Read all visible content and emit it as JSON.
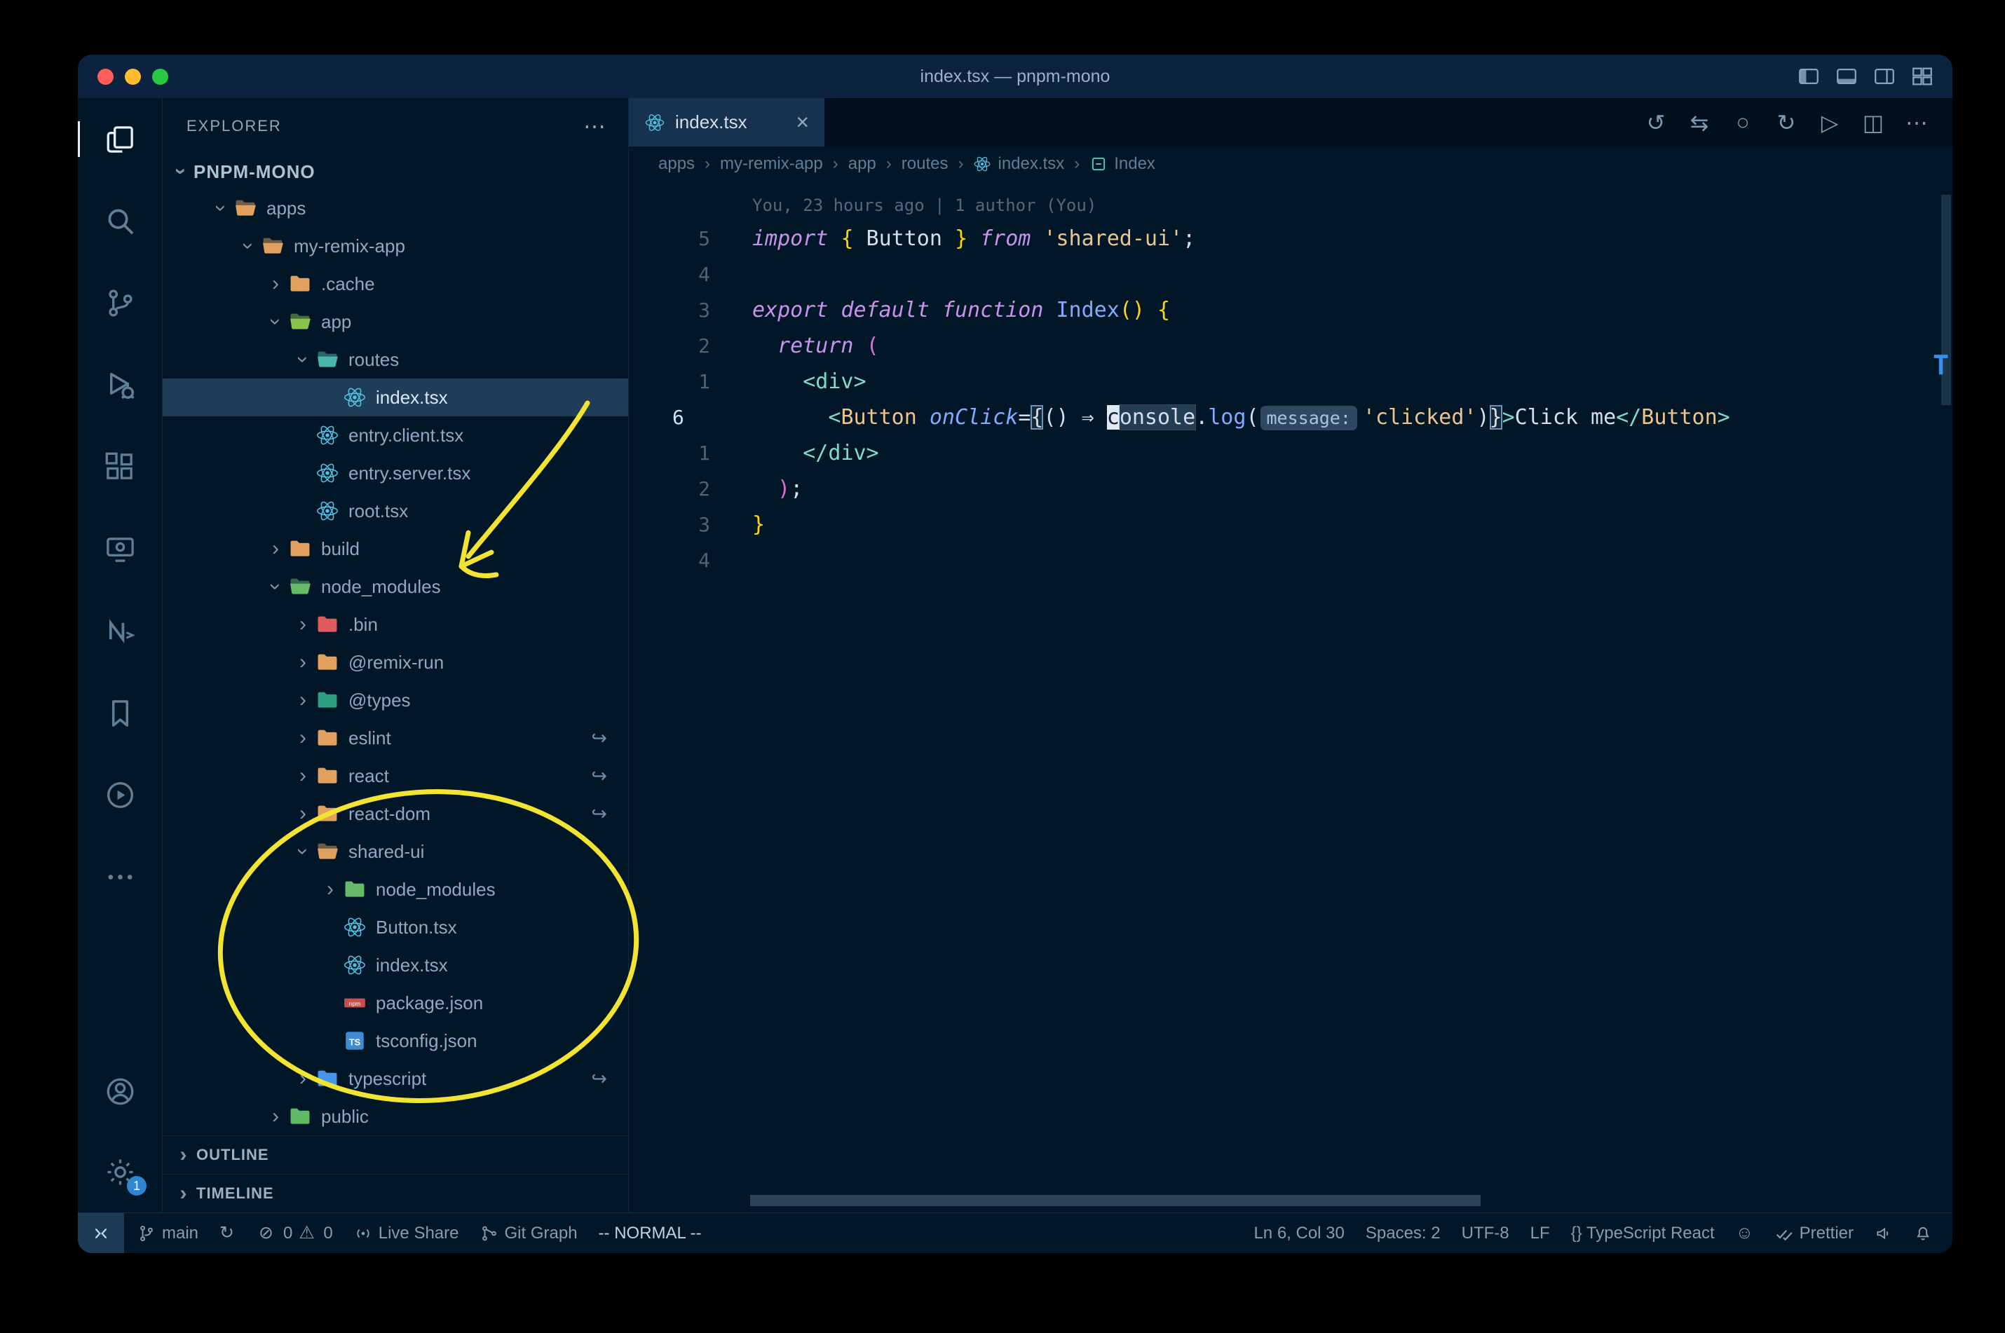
{
  "window": {
    "title": "index.tsx — pnpm-mono"
  },
  "title_bar": {
    "actions": [
      {
        "name": "toggle-sidebar"
      },
      {
        "name": "toggle-panel"
      },
      {
        "name": "toggle-secondary-sidebar"
      },
      {
        "name": "customize-layout"
      }
    ]
  },
  "activity_bar": {
    "items": [
      {
        "name": "explorer",
        "active": true
      },
      {
        "name": "search"
      },
      {
        "name": "source-control"
      },
      {
        "name": "run-debug"
      },
      {
        "name": "extensions"
      },
      {
        "name": "remote-explorer"
      },
      {
        "name": "nx-console"
      },
      {
        "name": "bookmarks"
      },
      {
        "name": "code-runner"
      },
      {
        "name": "more-actions"
      }
    ],
    "bottom": [
      {
        "name": "accounts"
      },
      {
        "name": "settings",
        "badge": "1"
      }
    ]
  },
  "explorer": {
    "header": "EXPLORER",
    "more_icon": "ellipsis",
    "root": "PNPM-MONO",
    "items": [
      {
        "label": "apps",
        "level": 1,
        "chevron": "expanded",
        "icon": "folder-open",
        "color": "#e2a05e"
      },
      {
        "label": "my-remix-app",
        "level": 2,
        "chevron": "expanded",
        "icon": "folder-open",
        "color": "#e2a05e"
      },
      {
        "label": ".cache",
        "level": 3,
        "chevron": "collapsed",
        "icon": "folder",
        "color": "#e2a05e"
      },
      {
        "label": "app",
        "level": 3,
        "chevron": "expanded",
        "icon": "folder-open",
        "color": "#8ac34b"
      },
      {
        "label": "routes",
        "level": 4,
        "chevron": "expanded",
        "icon": "folder-open",
        "color": "#4db6ac"
      },
      {
        "label": "index.tsx",
        "level": 5,
        "icon": "react",
        "selected": true
      },
      {
        "label": "entry.client.tsx",
        "level": 4,
        "icon": "react"
      },
      {
        "label": "entry.server.tsx",
        "level": 4,
        "icon": "react"
      },
      {
        "label": "root.tsx",
        "level": 4,
        "icon": "react"
      },
      {
        "label": "build",
        "level": 3,
        "chevron": "collapsed",
        "icon": "folder",
        "color": "#e2a05e"
      },
      {
        "label": "node_modules",
        "level": 3,
        "chevron": "expanded",
        "icon": "folder-open",
        "color": "#66bb6a"
      },
      {
        "label": ".bin",
        "level": 4,
        "chevron": "collapsed",
        "icon": "folder",
        "color": "#e05c5c"
      },
      {
        "label": "@remix-run",
        "level": 4,
        "chevron": "collapsed",
        "icon": "folder",
        "color": "#e2a05e"
      },
      {
        "label": "@types",
        "level": 4,
        "chevron": "collapsed",
        "icon": "folder",
        "color": "#2e9f7f"
      },
      {
        "label": "eslint",
        "level": 4,
        "chevron": "collapsed",
        "icon": "folder",
        "color": "#e2a05e",
        "symlink": true
      },
      {
        "label": "react",
        "level": 4,
        "chevron": "collapsed",
        "icon": "folder",
        "color": "#e2a05e",
        "symlink": true
      },
      {
        "label": "react-dom",
        "level": 4,
        "chevron": "collapsed",
        "icon": "folder",
        "color": "#e2a05e",
        "symlink": true
      },
      {
        "label": "shared-ui",
        "level": 4,
        "chevron": "expanded",
        "icon": "folder-open",
        "color": "#e2a05e"
      },
      {
        "label": "node_modules",
        "level": 5,
        "chevron": "collapsed",
        "icon": "folder",
        "color": "#66bb6a"
      },
      {
        "label": "Button.tsx",
        "level": 5,
        "icon": "react"
      },
      {
        "label": "index.tsx",
        "level": 5,
        "icon": "react"
      },
      {
        "label": "package.json",
        "level": 5,
        "icon": "npm"
      },
      {
        "label": "tsconfig.json",
        "level": 5,
        "icon": "ts"
      },
      {
        "label": "typescript",
        "level": 4,
        "chevron": "collapsed",
        "icon": "folder",
        "color": "#4596e8",
        "symlink": true
      },
      {
        "label": "public",
        "level": 3,
        "chevron": "collapsed",
        "icon": "folder",
        "color": "#5fb965"
      }
    ],
    "sections": [
      "OUTLINE",
      "TIMELINE"
    ]
  },
  "tabs": [
    {
      "label": "index.tsx",
      "icon": "react",
      "active": true
    }
  ],
  "editor_actions": [
    {
      "name": "timeline",
      "glyph": "↺"
    },
    {
      "name": "compare-changes",
      "glyph": "⇆"
    },
    {
      "name": "record",
      "glyph": "○"
    },
    {
      "name": "sync-file",
      "glyph": "↻"
    },
    {
      "name": "run-file",
      "glyph": "▷"
    },
    {
      "name": "split-editor",
      "glyph": "◫"
    },
    {
      "name": "more-actions",
      "glyph": "⋯"
    }
  ],
  "breadcrumbs": [
    {
      "label": "apps"
    },
    {
      "label": "my-remix-app"
    },
    {
      "label": "app"
    },
    {
      "label": "routes"
    },
    {
      "label": "index.tsx",
      "icon": "react"
    },
    {
      "label": "Index",
      "icon": "symbol-module"
    }
  ],
  "editor": {
    "minimap_letter": "T",
    "lines": [
      {
        "blame": "You, 23 hours ago | 1 author (You)"
      },
      {
        "g": "5",
        "t": [
          [
            "import",
            "kw"
          ],
          [
            " ",
            "p"
          ],
          [
            "{",
            "gold"
          ],
          [
            " Button ",
            "p"
          ],
          [
            "}",
            "gold"
          ],
          [
            " ",
            "p"
          ],
          [
            "from",
            "kw"
          ],
          [
            " ",
            "p"
          ],
          [
            "'shared-ui'",
            "str"
          ],
          [
            ";",
            "p"
          ]
        ]
      },
      {
        "g": "4",
        "t": []
      },
      {
        "g": "3",
        "t": [
          [
            "export",
            "kw"
          ],
          [
            " ",
            "p"
          ],
          [
            "default",
            "kw"
          ],
          [
            " ",
            "p"
          ],
          [
            "function",
            "kw"
          ],
          [
            " ",
            "p"
          ],
          [
            "Index",
            "fn"
          ],
          [
            "()",
            "gold"
          ],
          [
            " ",
            "p"
          ],
          [
            "{",
            "gold"
          ]
        ]
      },
      {
        "g": "2",
        "t": [
          [
            "  ",
            "p"
          ],
          [
            "return",
            "kw"
          ],
          [
            " ",
            "p"
          ],
          [
            "(",
            "orc"
          ]
        ]
      },
      {
        "g": "1",
        "t": [
          [
            "    ",
            "p"
          ],
          [
            "<div>",
            "tag"
          ]
        ]
      },
      {
        "g": "6",
        "cur": true,
        "t": [
          [
            "      ",
            "p"
          ],
          [
            "<",
            "tag"
          ],
          [
            "Button",
            "cmp"
          ],
          [
            " ",
            "p"
          ],
          [
            "onClick",
            "attr"
          ],
          [
            "=",
            "p"
          ],
          [
            "{",
            "box"
          ],
          [
            "()",
            "p"
          ],
          [
            " ",
            "p"
          ],
          [
            "⇒",
            "p"
          ],
          [
            " ",
            "p"
          ],
          [
            "c",
            "cursor"
          ],
          [
            "onsole",
            "whl"
          ],
          [
            ".",
            "p"
          ],
          [
            "log",
            "fn"
          ],
          [
            "(",
            "p"
          ],
          [
            "message:",
            "chip"
          ],
          [
            "'clicked'",
            "str"
          ],
          [
            ")",
            "p"
          ],
          [
            "}",
            "box"
          ],
          [
            ">",
            "tag"
          ],
          [
            "Click me",
            "p"
          ],
          [
            "</",
            "tag"
          ],
          [
            "Button",
            "cmp"
          ],
          [
            ">",
            "tag"
          ]
        ]
      },
      {
        "g": "1",
        "t": [
          [
            "    ",
            "p"
          ],
          [
            "</div>",
            "tag"
          ]
        ]
      },
      {
        "g": "2",
        "t": [
          [
            "  ",
            "p"
          ],
          [
            ")",
            "orc"
          ],
          [
            ";",
            "p"
          ]
        ]
      },
      {
        "g": "3",
        "t": [
          [
            "}",
            "gold"
          ]
        ]
      },
      {
        "g": "4",
        "t": []
      }
    ]
  },
  "status_bar": {
    "left": [
      {
        "name": "remote-indicator",
        "icon": "remote",
        "label": ""
      },
      {
        "name": "git-branch",
        "icon": "git-branch",
        "label": "main"
      },
      {
        "name": "sync",
        "icon": "sync",
        "label": ""
      },
      {
        "name": "problems",
        "parts": [
          [
            "error",
            "0"
          ],
          [
            "warning",
            "0"
          ]
        ]
      },
      {
        "name": "live-share",
        "icon": "live-share",
        "label": "Live Share"
      },
      {
        "name": "git-graph",
        "icon": "git-graph",
        "label": "Git Graph"
      },
      {
        "name": "vim-mode",
        "label": "-- NORMAL --"
      }
    ],
    "right": [
      {
        "name": "cursor-position",
        "label": "Ln 6, Col 30"
      },
      {
        "name": "indentation",
        "label": "Spaces: 2"
      },
      {
        "name": "encoding",
        "label": "UTF-8"
      },
      {
        "name": "eol",
        "label": "LF"
      },
      {
        "name": "language-mode",
        "label": "{} TypeScript React"
      },
      {
        "name": "feedback",
        "icon": "smiley",
        "label": ""
      },
      {
        "name": "prettier",
        "icon": "check-double",
        "label": "Prettier"
      },
      {
        "name": "broadcast",
        "icon": "broadcast",
        "label": ""
      },
      {
        "name": "notifications",
        "icon": "bell",
        "label": ""
      }
    ]
  },
  "annotations": {
    "color": "#f2e430"
  }
}
